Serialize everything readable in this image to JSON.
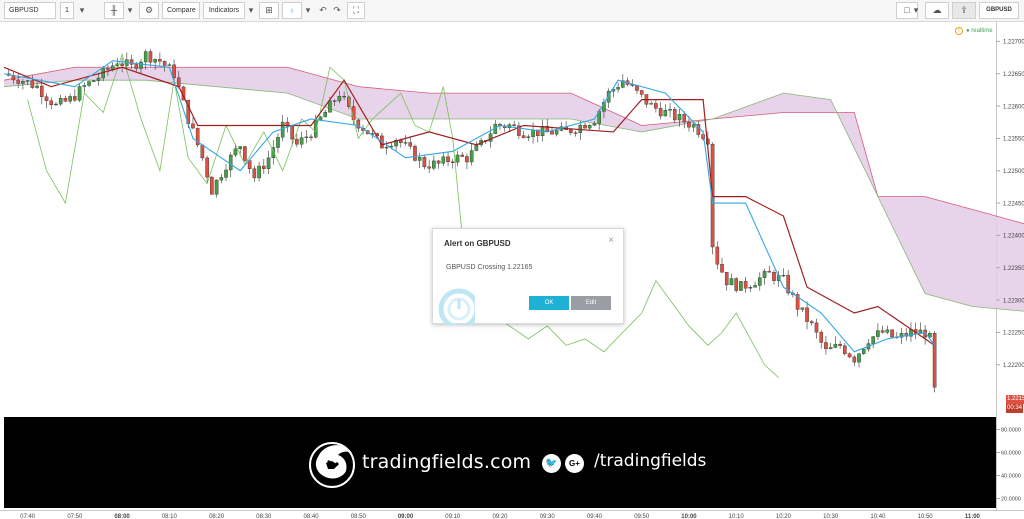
{
  "toolbar": {
    "symbol": "GBPUSD",
    "interval": "1",
    "compare_label": "Compare",
    "indicators_label": "Indicators",
    "symbol_badge": "GBPUSD"
  },
  "realtime_label": "realtime",
  "price_scale": {
    "labels": [
      "1.22700",
      "1.22650",
      "1.22600",
      "1.22550",
      "1.22500",
      "1.22450",
      "1.22400",
      "1.22350",
      "1.22300",
      "1.22250",
      "1.22200"
    ],
    "current_price": "1.22153",
    "countdown": "00:34"
  },
  "indicator_scale": {
    "labels": [
      "80.0000",
      "60.0000",
      "40.0000",
      "20.0000"
    ]
  },
  "time_axis": {
    "labels": [
      "07:40",
      "07:50",
      "08:00",
      "08:10",
      "08:20",
      "08:30",
      "08:40",
      "08:50",
      "09:00",
      "09:10",
      "09:20",
      "09:30",
      "09:40",
      "09:50",
      "10:00",
      "10:10",
      "10:20",
      "10:30",
      "10:40",
      "10:50",
      "11:00"
    ],
    "bold": [
      "08:00",
      "09:00",
      "10:00",
      "11:00"
    ]
  },
  "alert": {
    "title": "Alert on GBPUSD",
    "message": "GBPUSD Crossing 1.22165",
    "ok_label": "OK",
    "edit_label": "Edit"
  },
  "banner": {
    "brand": "tradingfields.com",
    "social_handle": "/tradingfields",
    "google_plus_glyph": "G+"
  },
  "chart_data": {
    "type": "candlestick",
    "symbol": "GBPUSD",
    "ylim": [
      1.2213,
      1.2273
    ],
    "indicator_ylim": [
      10,
      90
    ],
    "x_range_minutes": [
      455,
      665
    ],
    "colors": {
      "up": "#43a047",
      "down": "#e05040",
      "tenkan": "#35a7e0",
      "kijun": "#a02020",
      "chikou": "#78c15a",
      "cloud": "#e3cbe6",
      "span_b": "#d65a78",
      "span_a": "#88b878"
    },
    "candles_note_start": "07:33",
    "price_path": [
      [
        455,
        1.2265
      ],
      [
        459,
        1.2264
      ],
      [
        462,
        1.2263
      ],
      [
        466,
        1.226
      ],
      [
        469,
        1.2261
      ],
      [
        472,
        1.2263
      ],
      [
        476,
        1.2265
      ],
      [
        479,
        1.2267
      ],
      [
        482,
        1.2266
      ],
      [
        485,
        1.2268
      ],
      [
        488,
        1.2267
      ],
      [
        491,
        1.2265
      ],
      [
        494,
        1.2258
      ],
      [
        497,
        1.2252
      ],
      [
        499,
        1.2247
      ],
      [
        502,
        1.2251
      ],
      [
        505,
        1.2254
      ],
      [
        508,
        1.2249
      ],
      [
        511,
        1.2252
      ],
      [
        514,
        1.2257
      ],
      [
        517,
        1.2254
      ],
      [
        520,
        1.2256
      ],
      [
        523,
        1.2259
      ],
      [
        526,
        1.2262
      ],
      [
        529,
        1.2258
      ],
      [
        532,
        1.2256
      ],
      [
        535,
        1.2254
      ],
      [
        538,
        1.2255
      ],
      [
        541,
        1.2253
      ],
      [
        544,
        1.2251
      ],
      [
        547,
        1.2251
      ],
      [
        550,
        1.2252
      ],
      [
        553,
        1.2252
      ],
      [
        556,
        1.2254
      ],
      [
        559,
        1.2257
      ],
      [
        562,
        1.2257
      ],
      [
        565,
        1.2256
      ],
      [
        568,
        1.2256
      ],
      [
        571,
        1.2256
      ],
      [
        574,
        1.2256
      ],
      [
        577,
        1.2257
      ],
      [
        580,
        1.2258
      ],
      [
        583,
        1.2262
      ],
      [
        586,
        1.2264
      ],
      [
        589,
        1.2262
      ],
      [
        592,
        1.226
      ],
      [
        595,
        1.2259
      ],
      [
        598,
        1.2258
      ],
      [
        601,
        1.2257
      ],
      [
        604,
        1.2255
      ],
      [
        604.5,
        1.224
      ],
      [
        606,
        1.2236
      ],
      [
        608,
        1.2233
      ],
      [
        611,
        1.2232
      ],
      [
        614,
        1.2233
      ],
      [
        617,
        1.2234
      ],
      [
        620,
        1.2233
      ],
      [
        623,
        1.2229
      ],
      [
        626,
        1.2226
      ],
      [
        629,
        1.2222
      ],
      [
        632,
        1.2223
      ],
      [
        635,
        1.2221
      ],
      [
        638,
        1.2224
      ],
      [
        641,
        1.2225
      ],
      [
        644,
        1.2224
      ],
      [
        647,
        1.2225
      ],
      [
        650,
        1.2225
      ],
      [
        651,
        1.2224
      ],
      [
        652,
        1.2216
      ]
    ],
    "tenkan": [
      [
        455,
        1.2265
      ],
      [
        470,
        1.2263
      ],
      [
        478,
        1.2267
      ],
      [
        490,
        1.2266
      ],
      [
        495,
        1.2255
      ],
      [
        505,
        1.225
      ],
      [
        512,
        1.2256
      ],
      [
        520,
        1.2258
      ],
      [
        530,
        1.2257
      ],
      [
        540,
        1.2252
      ],
      [
        550,
        1.2253
      ],
      [
        560,
        1.2257
      ],
      [
        570,
        1.2256
      ],
      [
        580,
        1.2258
      ],
      [
        585,
        1.2264
      ],
      [
        595,
        1.2262
      ],
      [
        603,
        1.2256
      ],
      [
        605,
        1.2245
      ],
      [
        612,
        1.2245
      ],
      [
        620,
        1.2232
      ],
      [
        628,
        1.2228
      ],
      [
        635,
        1.2222
      ],
      [
        642,
        1.2224
      ],
      [
        650,
        1.2225
      ],
      [
        652,
        1.2223
      ]
    ],
    "kijun": [
      [
        455,
        1.2266
      ],
      [
        465,
        1.2263
      ],
      [
        480,
        1.2266
      ],
      [
        492,
        1.2263
      ],
      [
        496,
        1.2257
      ],
      [
        520,
        1.2257
      ],
      [
        527,
        1.2264
      ],
      [
        535,
        1.2254
      ],
      [
        545,
        1.2256
      ],
      [
        555,
        1.2254
      ],
      [
        565,
        1.2257
      ],
      [
        584,
        1.2256
      ],
      [
        590,
        1.2261
      ],
      [
        603,
        1.2261
      ],
      [
        605,
        1.2246
      ],
      [
        612,
        1.2246
      ],
      [
        620,
        1.2243
      ],
      [
        625,
        1.2232
      ],
      [
        635,
        1.2228
      ],
      [
        640,
        1.2229
      ],
      [
        652,
        1.2223
      ]
    ],
    "chikou": [
      [
        460,
        1.2261
      ],
      [
        464,
        1.225
      ],
      [
        468,
        1.2245
      ],
      [
        472,
        1.2262
      ],
      [
        476,
        1.2259
      ],
      [
        480,
        1.2268
      ],
      [
        484,
        1.2258
      ],
      [
        488,
        1.225
      ],
      [
        491,
        1.2264
      ],
      [
        494,
        1.2252
      ],
      [
        498,
        1.2248
      ],
      [
        502,
        1.2257
      ],
      [
        506,
        1.2251
      ],
      [
        510,
        1.2256
      ],
      [
        514,
        1.225
      ],
      [
        518,
        1.2258
      ],
      [
        521,
        1.2256
      ],
      [
        524,
        1.2266
      ],
      [
        527,
        1.2264
      ],
      [
        530,
        1.2255
      ],
      [
        533,
        1.2258
      ],
      [
        536,
        1.226
      ],
      [
        539,
        1.2262
      ],
      [
        542,
        1.2257
      ],
      [
        545,
        1.2256
      ],
      [
        548,
        1.2263
      ],
      [
        550,
        1.2255
      ],
      [
        552,
        1.224
      ],
      [
        555,
        1.2233
      ],
      [
        558,
        1.2228
      ],
      [
        562,
        1.2226
      ],
      [
        566,
        1.2224
      ],
      [
        570,
        1.2226
      ],
      [
        574,
        1.2223
      ],
      [
        578,
        1.2224
      ],
      [
        582,
        1.2222
      ],
      [
        586,
        1.2225
      ],
      [
        590,
        1.2228
      ],
      [
        593,
        1.2233
      ],
      [
        597,
        1.2229
      ],
      [
        600,
        1.2226
      ],
      [
        604,
        1.2223
      ],
      [
        607,
        1.2225
      ],
      [
        610,
        1.2228
      ],
      [
        613,
        1.2224
      ],
      [
        616,
        1.222
      ],
      [
        619,
        1.2218
      ]
    ],
    "span_a": [
      [
        455,
        1.2263
      ],
      [
        470,
        1.2264
      ],
      [
        485,
        1.2264
      ],
      [
        500,
        1.2263
      ],
      [
        515,
        1.2262
      ],
      [
        530,
        1.2258
      ],
      [
        545,
        1.2258
      ],
      [
        560,
        1.2258
      ],
      [
        575,
        1.2258
      ],
      [
        590,
        1.2256
      ],
      [
        605,
        1.2258
      ],
      [
        620,
        1.2262
      ],
      [
        630,
        1.2261
      ],
      [
        640,
        1.2246
      ],
      [
        650,
        1.2231
      ],
      [
        660,
        1.2229
      ],
      [
        675,
        1.2228
      ],
      [
        690,
        1.2227
      ],
      [
        700,
        1.2225
      ]
    ],
    "span_b": [
      [
        455,
        1.2264
      ],
      [
        470,
        1.2266
      ],
      [
        485,
        1.2266
      ],
      [
        500,
        1.2266
      ],
      [
        515,
        1.2266
      ],
      [
        530,
        1.2263
      ],
      [
        545,
        1.2262
      ],
      [
        560,
        1.2262
      ],
      [
        575,
        1.2262
      ],
      [
        590,
        1.2257
      ],
      [
        605,
        1.2258
      ],
      [
        620,
        1.2259
      ],
      [
        635,
        1.2259
      ],
      [
        640,
        1.2246
      ],
      [
        650,
        1.2246
      ],
      [
        660,
        1.2244
      ],
      [
        670,
        1.2242
      ],
      [
        680,
        1.224
      ],
      [
        690,
        1.2228
      ],
      [
        700,
        1.2226
      ]
    ]
  }
}
